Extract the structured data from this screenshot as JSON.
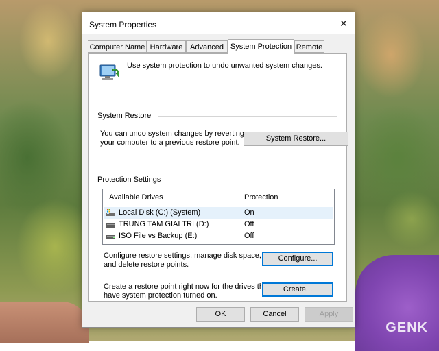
{
  "window": {
    "title": "System Properties",
    "close_glyph": "✕"
  },
  "tabs": [
    {
      "label": "Computer Name"
    },
    {
      "label": "Hardware"
    },
    {
      "label": "Advanced"
    },
    {
      "label": "System Protection",
      "active": true
    },
    {
      "label": "Remote"
    }
  ],
  "intro": {
    "icon": "system-protection-icon",
    "text": "Use system protection to undo unwanted system changes."
  },
  "system_restore": {
    "group_label": "System Restore",
    "description_line1": "You can undo system changes by reverting",
    "description_line2": "your computer to a previous restore point.",
    "button_label": "System Restore..."
  },
  "protection_settings": {
    "group_label": "Protection Settings",
    "columns": [
      "Available Drives",
      "Protection"
    ],
    "drives": [
      {
        "name": "Local Disk (C:) (System)",
        "protection": "On",
        "icon": "system-drive-icon",
        "selected": true
      },
      {
        "name": "TRUNG TAM GIAI TRI  (D:)",
        "protection": "Off",
        "icon": "drive-icon"
      },
      {
        "name": "ISO File vs Backup (E:)",
        "protection": "Off",
        "icon": "drive-icon"
      }
    ],
    "configure_line1": "Configure restore settings, manage disk space,",
    "configure_line2": "and delete restore points.",
    "configure_button": "Configure...",
    "create_line1": "Create a restore point right now for the drives that",
    "create_line2": "have system protection turned on.",
    "create_button": "Create..."
  },
  "footer": {
    "ok": "OK",
    "cancel": "Cancel",
    "apply": "Apply"
  },
  "watermark": "GENK",
  "colors": {
    "accent": "#0078d7",
    "selection": "#e5f1fb",
    "dialog_bg": "#f0f0f0"
  }
}
